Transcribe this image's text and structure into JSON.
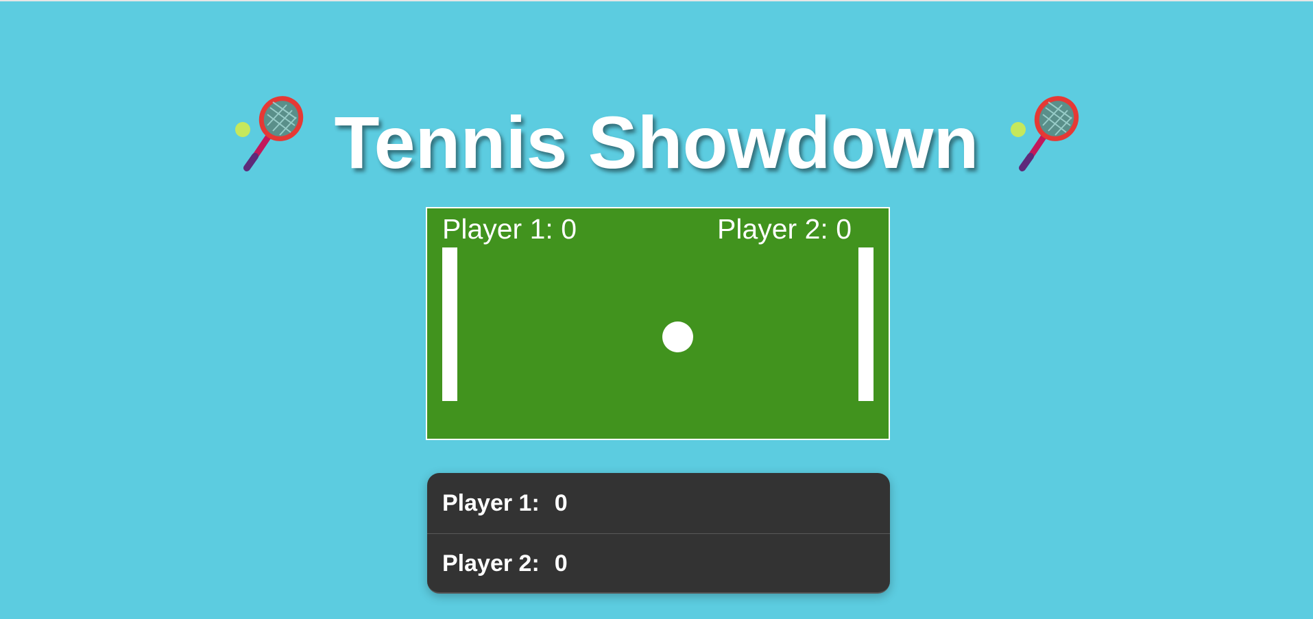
{
  "page": {
    "title": "Tennis Showdown",
    "title_icon": "tennis-racket-emoji",
    "background_color": "#5ccce0"
  },
  "court": {
    "color": "#41931e",
    "player1_score_text": "Player 1: 0",
    "player2_score_text": "Player 2: 0"
  },
  "scoreboard": {
    "rows": [
      {
        "label": "Player 1:",
        "score": "0"
      },
      {
        "label": "Player 2:",
        "score": "0"
      }
    ]
  }
}
